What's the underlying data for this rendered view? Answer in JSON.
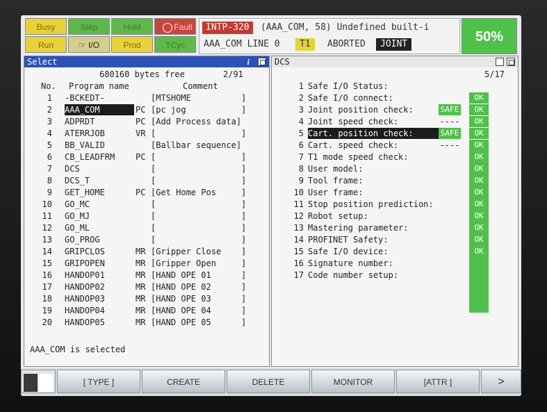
{
  "status_buttons": [
    "Busy",
    "Step",
    "Hold",
    "Fault",
    "Run",
    "I/O",
    "Prod",
    "TCyc"
  ],
  "alarm": {
    "code": "INTP-320",
    "message": "(AAA_COM, 58) Undefined built-i",
    "program_line": "AAA_COM LINE 0",
    "mode": "T1",
    "status": "ABORTED",
    "coord": "JOINT"
  },
  "override": "50%",
  "left_pane": {
    "title": "Select",
    "bytes_free": "680160 bytes free",
    "page": "2/91",
    "headers": {
      "no": "No.",
      "name": "Program name",
      "comment": "Comment"
    },
    "rows": [
      {
        "no": "1",
        "name": "-BCKEDT-",
        "type": "",
        "comment": "[MTSHOME          ]"
      },
      {
        "no": "2",
        "name": "AAA_COM",
        "type": "PC",
        "comment": "[pc jog           ]"
      },
      {
        "no": "3",
        "name": "ADPRDT",
        "type": "PC",
        "comment": "[Add Process data]"
      },
      {
        "no": "4",
        "name": "ATERRJOB",
        "type": "VR",
        "comment": "[                 ]"
      },
      {
        "no": "5",
        "name": "BB_VALID",
        "type": "",
        "comment": "[Ballbar sequence]"
      },
      {
        "no": "6",
        "name": "CB_LEADFRM",
        "type": "PC",
        "comment": "[                 ]"
      },
      {
        "no": "7",
        "name": "DCS",
        "type": "",
        "comment": "[                 ]"
      },
      {
        "no": "8",
        "name": "DCS_T",
        "type": "",
        "comment": "[                 ]"
      },
      {
        "no": "9",
        "name": "GET_HOME",
        "type": "PC",
        "comment": "[Get Home Pos     ]"
      },
      {
        "no": "10",
        "name": "GO_MC",
        "type": "",
        "comment": "[                 ]"
      },
      {
        "no": "11",
        "name": "GO_MJ",
        "type": "",
        "comment": "[                 ]"
      },
      {
        "no": "12",
        "name": "GO_ML",
        "type": "",
        "comment": "[                 ]"
      },
      {
        "no": "13",
        "name": "GO_PROG",
        "type": "",
        "comment": "[                 ]"
      },
      {
        "no": "14",
        "name": "GRIPCLOS",
        "type": "MR",
        "comment": "[Gripper Close    ]"
      },
      {
        "no": "15",
        "name": "GRIPOPEN",
        "type": "MR",
        "comment": "[Gripper Open     ]"
      },
      {
        "no": "16",
        "name": "HANDOP01",
        "type": "MR",
        "comment": "[HAND OPE 01      ]"
      },
      {
        "no": "17",
        "name": "HANDOP02",
        "type": "MR",
        "comment": "[HAND OPE 02      ]"
      },
      {
        "no": "18",
        "name": "HANDOP03",
        "type": "MR",
        "comment": "[HAND OPE 03      ]"
      },
      {
        "no": "19",
        "name": "HANDOP04",
        "type": "MR",
        "comment": "[HAND OPE 04      ]"
      },
      {
        "no": "20",
        "name": "HANDOP05",
        "type": "MR",
        "comment": "[HAND OPE 05      ]"
      }
    ],
    "message": "AAA_COM is selected"
  },
  "right_pane": {
    "title": "DCS",
    "page": "5/17",
    "rows": [
      {
        "no": "1",
        "label": "Safe I/O Status:",
        "badge": "",
        "state": ""
      },
      {
        "no": "2",
        "label": "Safe I/O connect:",
        "badge": "",
        "state": "OK"
      },
      {
        "no": "3",
        "label": "Joint position check:",
        "badge": "SAFE",
        "state": "OK"
      },
      {
        "no": "4",
        "label": "Joint speed check:",
        "badge": "----",
        "state": "OK"
      },
      {
        "no": "5",
        "label": "Cart. position check:",
        "badge": "SAFE",
        "state": "OK"
      },
      {
        "no": "6",
        "label": "Cart. speed check:",
        "badge": "----",
        "state": "OK"
      },
      {
        "no": "7",
        "label": "T1 mode speed check:",
        "badge": "",
        "state": "OK"
      },
      {
        "no": "8",
        "label": "User model:",
        "badge": "",
        "state": "OK"
      },
      {
        "no": "9",
        "label": "Tool frame:",
        "badge": "",
        "state": "OK"
      },
      {
        "no": "10",
        "label": "User frame:",
        "badge": "",
        "state": "OK"
      },
      {
        "no": "11",
        "label": "Stop position prediction:",
        "badge": "",
        "state": "OK"
      },
      {
        "no": "12",
        "label": "Robot setup:",
        "badge": "",
        "state": "OK"
      },
      {
        "no": "13",
        "label": "Mastering parameter:",
        "badge": "",
        "state": "OK"
      },
      {
        "no": "14",
        "label": "PROFINET Safety:",
        "badge": "",
        "state": "OK"
      },
      {
        "no": "15",
        "label": "Safe I/O device:",
        "badge": "",
        "state": "OK"
      },
      {
        "no": "16",
        "label": "Signature number:",
        "badge": "",
        "state": ""
      },
      {
        "no": "17",
        "label": "Code number setup:",
        "badge": "",
        "state": ""
      }
    ]
  },
  "function_keys": [
    "[ TYPE ]",
    "CREATE",
    "DELETE",
    "MONITOR",
    "[ATTR ]",
    ">"
  ],
  "colors": {
    "select_title": "#2c51b8",
    "ok_green": "#4fc04a",
    "alarm_red": "#c43a31",
    "t1_yellow": "#e3d538"
  }
}
